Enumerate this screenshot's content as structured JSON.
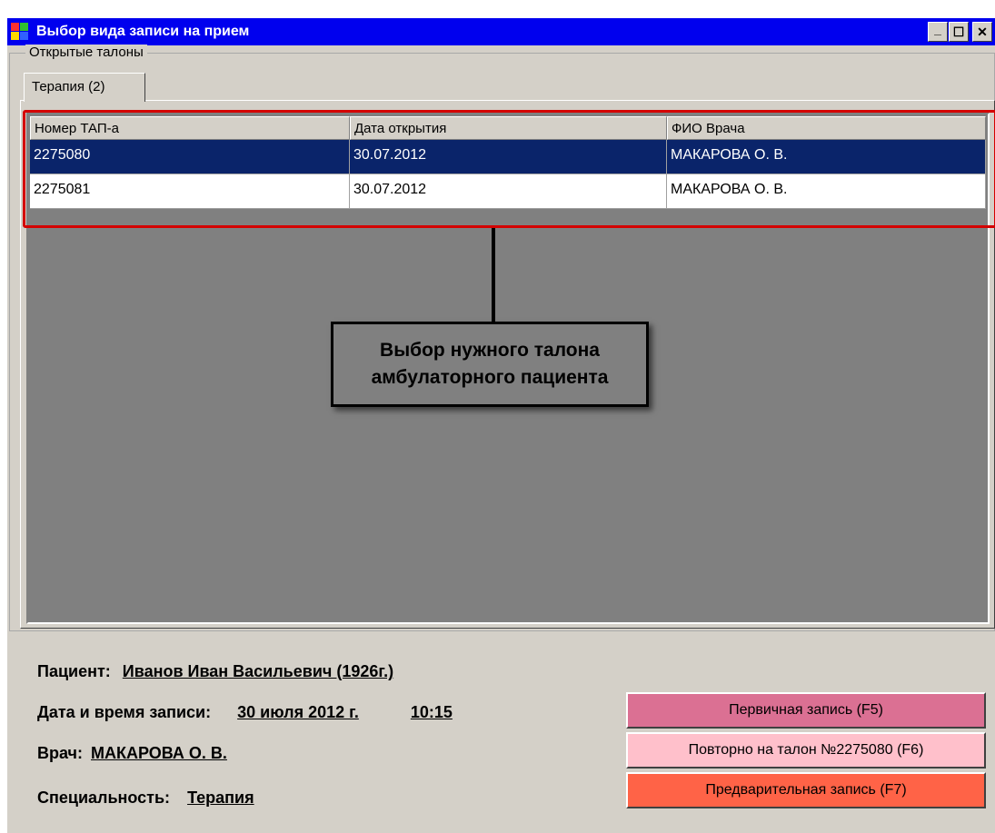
{
  "window": {
    "title": "Выбор вида записи на прием",
    "minimize_glyph": "_",
    "maximize_glyph": "☐",
    "close_glyph": "✕"
  },
  "groupbox": {
    "label": "Открытые талоны"
  },
  "tabs": [
    {
      "label": "Терапия (2)"
    }
  ],
  "grid": {
    "columns": [
      "Номер ТАП-а",
      "Дата открытия",
      "ФИО Врача"
    ],
    "rows": [
      {
        "number": "2275080",
        "date": "30.07.2012",
        "doctor": "МАКАРОВА О. В.",
        "selected": true
      },
      {
        "number": "2275081",
        "date": "30.07.2012",
        "doctor": "МАКАРОВА О. В.",
        "selected": false
      }
    ]
  },
  "annotation": {
    "line1": "Выбор нужного талона",
    "line2": "амбулаторного пациента",
    "highlight_color": "#d40000"
  },
  "info": {
    "patient_label": "Пациент:",
    "patient_value": "Иванов Иван Васильевич (1926г.)",
    "datetime_label": "Дата и время записи:",
    "date_value": "30 июля 2012 г.",
    "time_value": "10:15",
    "doctor_label": "Врач:",
    "doctor_value": "МАКАРОВА О. В.",
    "specialty_label": "Специальность:",
    "specialty_value": "Терапия"
  },
  "buttons": {
    "primary": {
      "label": "Первичная запись (F5)",
      "color": "#db7093"
    },
    "repeat": {
      "label": "Повторно на талон №2275080 (F6)",
      "color": "#ffc0cb"
    },
    "preliminary": {
      "label": "Предварительная запись (F7)",
      "color": "#ff6347"
    }
  },
  "colors": {
    "titlebar": "#0000ee",
    "selected_row": "#0a246a",
    "window_bg": "#d4d0c8",
    "grid_bg": "#808080"
  }
}
